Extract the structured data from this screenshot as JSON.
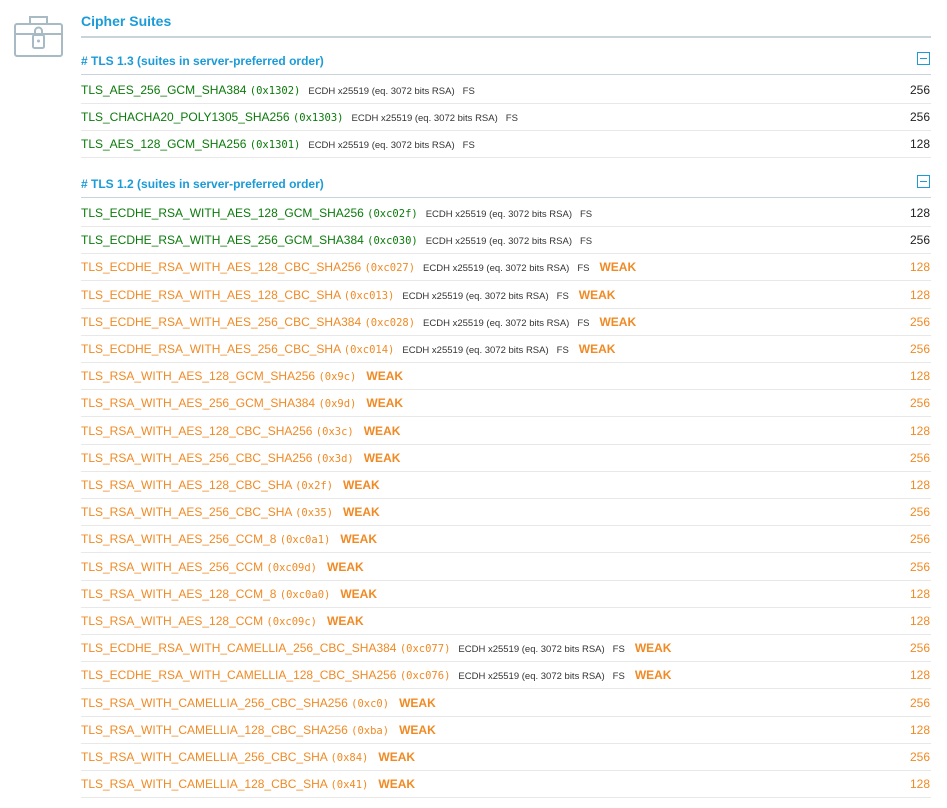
{
  "header": {
    "title": "Cipher Suites",
    "icon": "toolbox-lock-icon"
  },
  "colors": {
    "accent": "#1b9bd7",
    "strong": "#0a7a0a",
    "weak": "#f08a24"
  },
  "sections": [
    {
      "label": "# TLS 1.3 (suites in server-preferred order)",
      "rows": [
        {
          "name": "TLS_AES_256_GCM_SHA384",
          "code": "(0x1302)",
          "ex": "ECDH x25519 (eq. 3072 bits RSA)",
          "fs": "FS",
          "weak": "",
          "bits": "256",
          "status": "green"
        },
        {
          "name": "TLS_CHACHA20_POLY1305_SHA256",
          "code": "(0x1303)",
          "ex": "ECDH x25519 (eq. 3072 bits RSA)",
          "fs": "FS",
          "weak": "",
          "bits": "256",
          "status": "green"
        },
        {
          "name": "TLS_AES_128_GCM_SHA256",
          "code": "(0x1301)",
          "ex": "ECDH x25519 (eq. 3072 bits RSA)",
          "fs": "FS",
          "weak": "",
          "bits": "128",
          "status": "green"
        }
      ]
    },
    {
      "label": "# TLS 1.2 (suites in server-preferred order)",
      "rows": [
        {
          "name": "TLS_ECDHE_RSA_WITH_AES_128_GCM_SHA256",
          "code": "(0xc02f)",
          "ex": "ECDH x25519 (eq. 3072 bits RSA)",
          "fs": "FS",
          "weak": "",
          "bits": "128",
          "status": "green"
        },
        {
          "name": "TLS_ECDHE_RSA_WITH_AES_256_GCM_SHA384",
          "code": "(0xc030)",
          "ex": "ECDH x25519 (eq. 3072 bits RSA)",
          "fs": "FS",
          "weak": "",
          "bits": "256",
          "status": "green"
        },
        {
          "name": "TLS_ECDHE_RSA_WITH_AES_128_CBC_SHA256",
          "code": "(0xc027)",
          "ex": "ECDH x25519 (eq. 3072 bits RSA)",
          "fs": "FS",
          "weak": "WEAK",
          "bits": "128",
          "status": "orange"
        },
        {
          "name": "TLS_ECDHE_RSA_WITH_AES_128_CBC_SHA",
          "code": "(0xc013)",
          "ex": "ECDH x25519 (eq. 3072 bits RSA)",
          "fs": "FS",
          "weak": "WEAK",
          "bits": "128",
          "status": "orange"
        },
        {
          "name": "TLS_ECDHE_RSA_WITH_AES_256_CBC_SHA384",
          "code": "(0xc028)",
          "ex": "ECDH x25519 (eq. 3072 bits RSA)",
          "fs": "FS",
          "weak": "WEAK",
          "bits": "256",
          "status": "orange"
        },
        {
          "name": "TLS_ECDHE_RSA_WITH_AES_256_CBC_SHA",
          "code": "(0xc014)",
          "ex": "ECDH x25519 (eq. 3072 bits RSA)",
          "fs": "FS",
          "weak": "WEAK",
          "bits": "256",
          "status": "orange"
        },
        {
          "name": "TLS_RSA_WITH_AES_128_GCM_SHA256",
          "code": "(0x9c)",
          "ex": "",
          "fs": "",
          "weak": "WEAK",
          "bits": "128",
          "status": "orange"
        },
        {
          "name": "TLS_RSA_WITH_AES_256_GCM_SHA384",
          "code": "(0x9d)",
          "ex": "",
          "fs": "",
          "weak": "WEAK",
          "bits": "256",
          "status": "orange"
        },
        {
          "name": "TLS_RSA_WITH_AES_128_CBC_SHA256",
          "code": "(0x3c)",
          "ex": "",
          "fs": "",
          "weak": "WEAK",
          "bits": "128",
          "status": "orange"
        },
        {
          "name": "TLS_RSA_WITH_AES_256_CBC_SHA256",
          "code": "(0x3d)",
          "ex": "",
          "fs": "",
          "weak": "WEAK",
          "bits": "256",
          "status": "orange"
        },
        {
          "name": "TLS_RSA_WITH_AES_128_CBC_SHA",
          "code": "(0x2f)",
          "ex": "",
          "fs": "",
          "weak": "WEAK",
          "bits": "128",
          "status": "orange"
        },
        {
          "name": "TLS_RSA_WITH_AES_256_CBC_SHA",
          "code": "(0x35)",
          "ex": "",
          "fs": "",
          "weak": "WEAK",
          "bits": "256",
          "status": "orange"
        },
        {
          "name": "TLS_RSA_WITH_AES_256_CCM_8",
          "code": "(0xc0a1)",
          "ex": "",
          "fs": "",
          "weak": "WEAK",
          "bits": "256",
          "status": "orange"
        },
        {
          "name": "TLS_RSA_WITH_AES_256_CCM",
          "code": "(0xc09d)",
          "ex": "",
          "fs": "",
          "weak": "WEAK",
          "bits": "256",
          "status": "orange"
        },
        {
          "name": "TLS_RSA_WITH_AES_128_CCM_8",
          "code": "(0xc0a0)",
          "ex": "",
          "fs": "",
          "weak": "WEAK",
          "bits": "128",
          "status": "orange"
        },
        {
          "name": "TLS_RSA_WITH_AES_128_CCM",
          "code": "(0xc09c)",
          "ex": "",
          "fs": "",
          "weak": "WEAK",
          "bits": "128",
          "status": "orange"
        },
        {
          "name": "TLS_ECDHE_RSA_WITH_CAMELLIA_256_CBC_SHA384",
          "code": "(0xc077)",
          "ex": "ECDH x25519 (eq. 3072 bits RSA)",
          "fs": "FS",
          "weak": "WEAK",
          "bits": "256",
          "status": "orange"
        },
        {
          "name": "TLS_ECDHE_RSA_WITH_CAMELLIA_128_CBC_SHA256",
          "code": "(0xc076)",
          "ex": "ECDH x25519 (eq. 3072 bits RSA)",
          "fs": "FS",
          "weak": "WEAK",
          "bits": "128",
          "status": "orange"
        },
        {
          "name": "TLS_RSA_WITH_CAMELLIA_256_CBC_SHA256",
          "code": "(0xc0)",
          "ex": "",
          "fs": "",
          "weak": "WEAK",
          "bits": "256",
          "status": "orange"
        },
        {
          "name": "TLS_RSA_WITH_CAMELLIA_128_CBC_SHA256",
          "code": "(0xba)",
          "ex": "",
          "fs": "",
          "weak": "WEAK",
          "bits": "128",
          "status": "orange"
        },
        {
          "name": "TLS_RSA_WITH_CAMELLIA_256_CBC_SHA",
          "code": "(0x84)",
          "ex": "",
          "fs": "",
          "weak": "WEAK",
          "bits": "256",
          "status": "orange"
        },
        {
          "name": "TLS_RSA_WITH_CAMELLIA_128_CBC_SHA",
          "code": "(0x41)",
          "ex": "",
          "fs": "",
          "weak": "WEAK",
          "bits": "128",
          "status": "orange"
        }
      ]
    }
  ]
}
